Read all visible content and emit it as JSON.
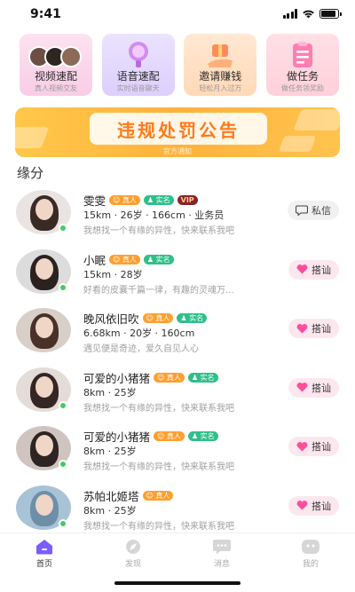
{
  "status_bar": {
    "time": "9:41",
    "battery_level": 0.9
  },
  "features": [
    {
      "title": "视频速配",
      "subtitle": "真人视频交友",
      "icon": "video-avatars-icon"
    },
    {
      "title": "语音速配",
      "subtitle": "实时语音聊天",
      "icon": "microphone-icon"
    },
    {
      "title": "邀请赚钱",
      "subtitle": "轻松月入过万",
      "icon": "gift-hand-icon"
    },
    {
      "title": "做任务",
      "subtitle": "做任务领奖励",
      "icon": "clipboard-icon"
    }
  ],
  "banner": {
    "title": "违规处罚公告",
    "subtitle": "官方通知"
  },
  "section_title": "缘分",
  "users": [
    {
      "name": "雯雯",
      "tags": [
        "真人",
        "实名"
      ],
      "vip": "VIP",
      "info": "15km · 26岁 · 166cm · 业务员",
      "bio": "我想找一个有缘的异性，快来联系我吧",
      "action": "私信",
      "action_icon": "chat-icon",
      "online": true,
      "avatar_color": "#3a2a24"
    },
    {
      "name": "小眠",
      "tags": [
        "真人",
        "实名"
      ],
      "vip": "",
      "info": "15km · 28岁",
      "bio": "好看的皮囊千篇一律，有趣的灵魂万...",
      "action": "搭讪",
      "action_icon": "heart-icon",
      "online": true,
      "avatar_color": "#2b2220"
    },
    {
      "name": "晚风依旧吹",
      "tags": [
        "真人",
        "实名"
      ],
      "vip": "",
      "info": "6.68km · 20岁 · 160cm",
      "bio": "遇见便是奇迹，爱久自见人心",
      "action": "搭讪",
      "action_icon": "heart-icon",
      "online": false,
      "avatar_color": "#4a3128"
    },
    {
      "name": "可爱的小猪猪",
      "tags": [
        "真人",
        "实名"
      ],
      "vip": "",
      "info": "8km · 25岁",
      "bio": "我想找一个有缘的异性，快来联系我吧",
      "action": "搭讪",
      "action_icon": "heart-icon",
      "online": true,
      "avatar_color": "#332624"
    },
    {
      "name": "可爱的小猪猪",
      "tags": [
        "真人",
        "实名"
      ],
      "vip": "",
      "info": "8km · 25岁",
      "bio": "我想找一个有缘的异性，快来联系我吧",
      "action": "搭讪",
      "action_icon": "heart-icon",
      "online": true,
      "avatar_color": "#2e2422"
    },
    {
      "name": "苏帕北姬塔",
      "tags": [
        "真人"
      ],
      "vip": "",
      "info": "8km · 25岁",
      "bio": "我想找一个有缘的异性，快来联系我吧",
      "action": "搭讪",
      "action_icon": "heart-icon",
      "online": true,
      "avatar_color": "#6d8fa8"
    }
  ],
  "tabs": [
    {
      "label": "首页",
      "icon": "home-icon",
      "active": true
    },
    {
      "label": "发现",
      "icon": "compass-icon",
      "active": false
    },
    {
      "label": "消息",
      "icon": "message-icon",
      "active": false
    },
    {
      "label": "我的",
      "icon": "profile-icon",
      "active": false
    }
  ],
  "colors": {
    "accent": "#ff7a1a",
    "brand_purple": "#7b5cff",
    "online": "#3ecf5e",
    "heart": "#ff4f9a"
  }
}
